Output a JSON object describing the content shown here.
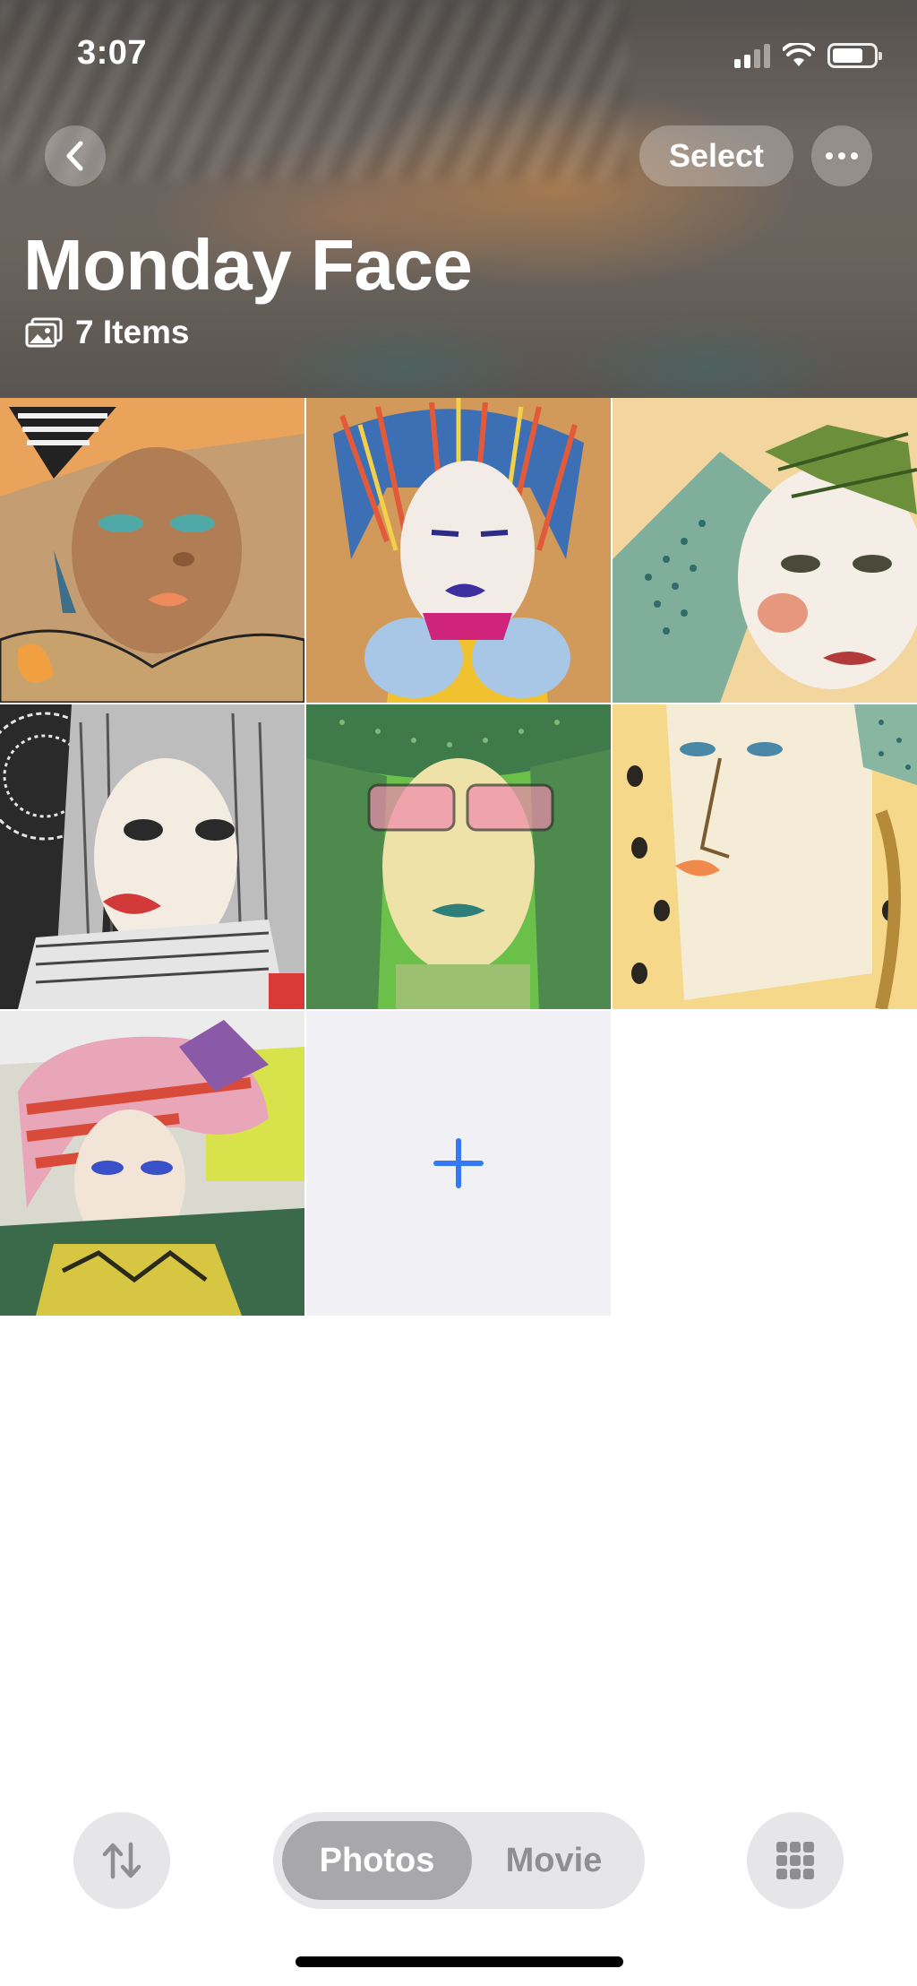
{
  "status_bar": {
    "time": "3:07"
  },
  "header": {
    "select_label": "Select",
    "album_title": "Monday Face",
    "item_count": "7 Items"
  },
  "grid": {
    "photos": [
      {
        "name": "photo-face-1",
        "description_icon": "portrait-image"
      },
      {
        "name": "photo-face-2",
        "description_icon": "portrait-image"
      },
      {
        "name": "photo-face-3",
        "description_icon": "portrait-image"
      },
      {
        "name": "photo-face-4",
        "description_icon": "portrait-image"
      },
      {
        "name": "photo-face-5",
        "description_icon": "portrait-image"
      },
      {
        "name": "photo-face-6",
        "description_icon": "portrait-image"
      },
      {
        "name": "photo-face-7",
        "description_icon": "portrait-image"
      }
    ],
    "add_icon": "plus-icon"
  },
  "bottom_bar": {
    "sort_icon": "sort-arrows-icon",
    "segments": [
      "Photos",
      "Movie"
    ],
    "selected_segment": "Photos",
    "grid_icon": "grid-icon"
  },
  "colors": {
    "accent": "#3478f6",
    "segment_active": "#a8a8aa",
    "segment_background": "#e6e6e8",
    "add_tile_background": "#f0f0f5"
  }
}
